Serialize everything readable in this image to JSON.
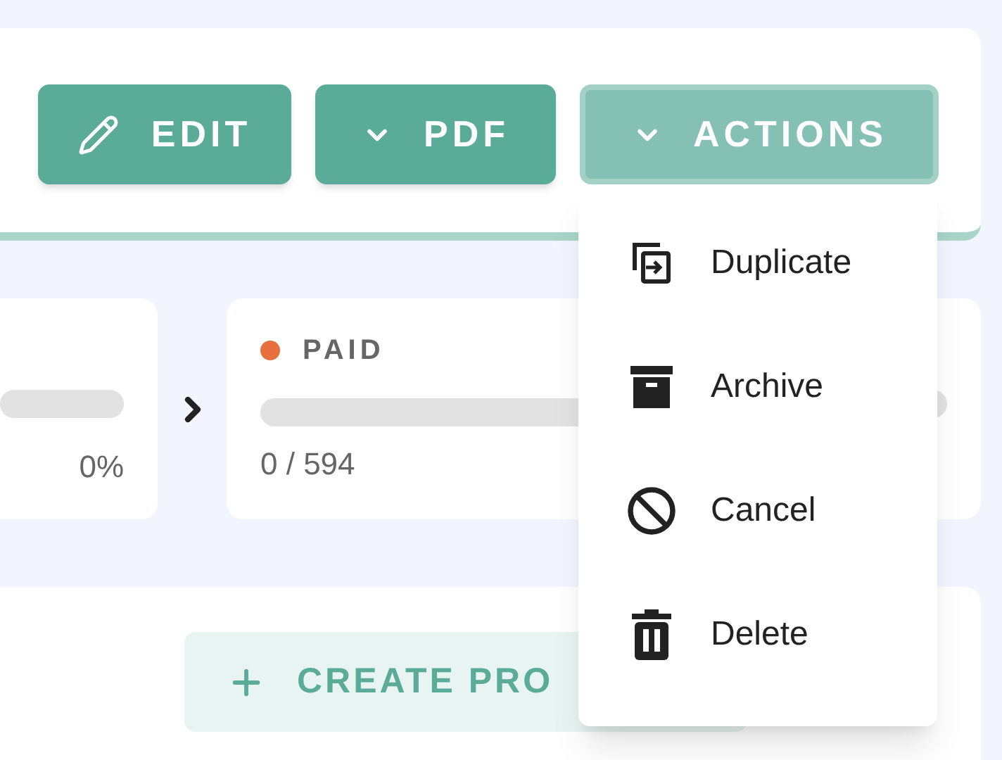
{
  "toolbar": {
    "buttons": [
      {
        "kind": "edit",
        "label": "EDIT",
        "open": false
      },
      {
        "kind": "dropdown",
        "label": "PDF",
        "open": false
      },
      {
        "kind": "dropdown",
        "label": "ACTIONS",
        "open": true
      }
    ]
  },
  "stages": [
    {
      "percent": "0%"
    },
    {
      "label": "PAID",
      "color": "#e8703f",
      "count": "0 / 594"
    }
  ],
  "create_button": {
    "label": "CREATE PRO"
  },
  "actions_menu": {
    "items": [
      {
        "kind": "duplicate",
        "label": "Duplicate"
      },
      {
        "kind": "archive",
        "label": "Archive"
      },
      {
        "kind": "cancel",
        "label": "Cancel"
      },
      {
        "kind": "delete",
        "label": "Delete"
      }
    ]
  }
}
